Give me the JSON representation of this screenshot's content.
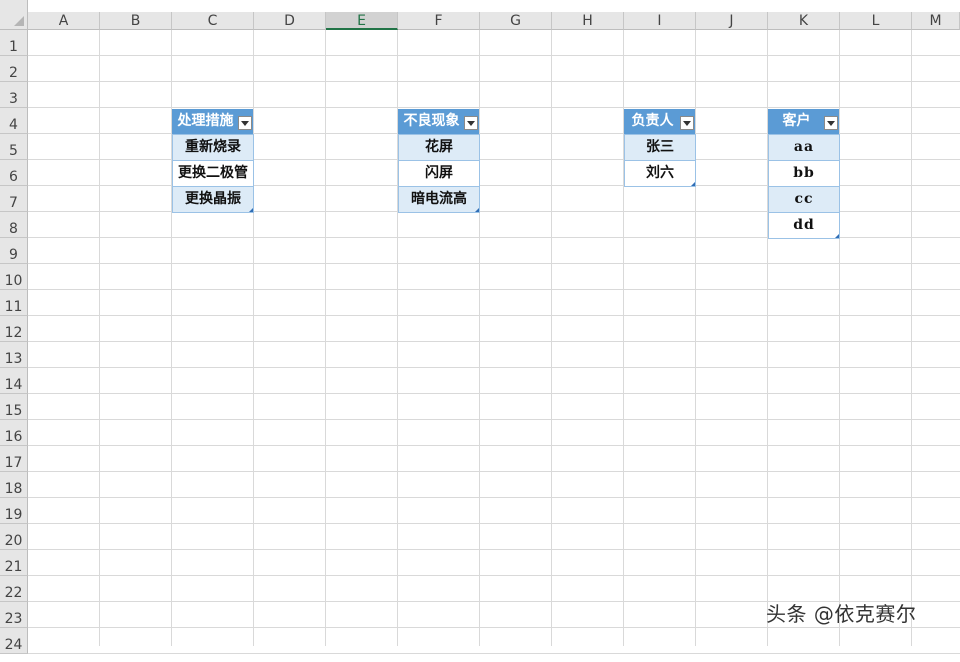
{
  "sheet": {
    "columns": [
      "A",
      "B",
      "C",
      "D",
      "E",
      "F",
      "G",
      "H",
      "I",
      "J",
      "K",
      "L",
      "M"
    ],
    "selected_column": "E",
    "rows": [
      "1",
      "2",
      "3",
      "4",
      "5",
      "6",
      "7",
      "8",
      "9",
      "10",
      "11",
      "12",
      "13",
      "14",
      "15",
      "16",
      "17",
      "18",
      "19",
      "20",
      "21",
      "22",
      "23",
      "24"
    ]
  },
  "tables": [
    {
      "header": "处理措施",
      "rows": [
        "重新烧录",
        "更换二极管",
        "更换晶振"
      ]
    },
    {
      "header": "不良现象",
      "rows": [
        "花屏",
        "闪屏",
        "暗电流高"
      ]
    },
    {
      "header": "负责人",
      "rows": [
        "张三",
        "刘六"
      ]
    },
    {
      "header": "客户",
      "rows": [
        "aa",
        "bb",
        "cc",
        "dd"
      ]
    }
  ],
  "colors": {
    "header_fill": "#5b9bd5",
    "band_fill": "#ddebf7",
    "selected_col_accent": "#217346"
  },
  "watermark": "头条 @依克赛尔"
}
